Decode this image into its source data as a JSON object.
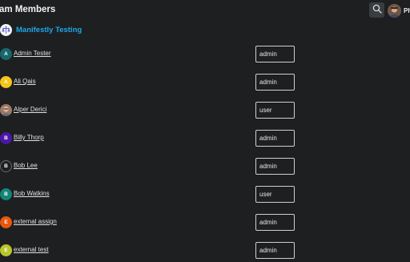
{
  "header": {
    "title": "am Members",
    "user_name": "Ph"
  },
  "org": {
    "name": "Manifestly Testing"
  },
  "members": [
    {
      "name": "Admin Tester",
      "role": "admin",
      "avatar_letter": "A",
      "avatar_color": "#17666b"
    },
    {
      "name": "Ali Qais",
      "role": "admin",
      "avatar_letter": "A",
      "avatar_color": "#f5c518"
    },
    {
      "name": "Alper Derici",
      "role": "user",
      "avatar_letter": "",
      "avatar_color": "#9c7a66"
    },
    {
      "name": "Billy Thorp",
      "role": "admin",
      "avatar_letter": "B",
      "avatar_color": "#4a17a8"
    },
    {
      "name": "Bob Lee",
      "role": "admin",
      "avatar_letter": "B",
      "avatar_color": "#1d1f21"
    },
    {
      "name": "Bob Watkins",
      "role": "user",
      "avatar_letter": "B",
      "avatar_color": "#138577"
    },
    {
      "name": "external assign",
      "role": "admin",
      "avatar_letter": "E",
      "avatar_color": "#e8580c"
    },
    {
      "name": "external test",
      "role": "admin",
      "avatar_letter": "E",
      "avatar_color": "#b7c62a"
    }
  ]
}
